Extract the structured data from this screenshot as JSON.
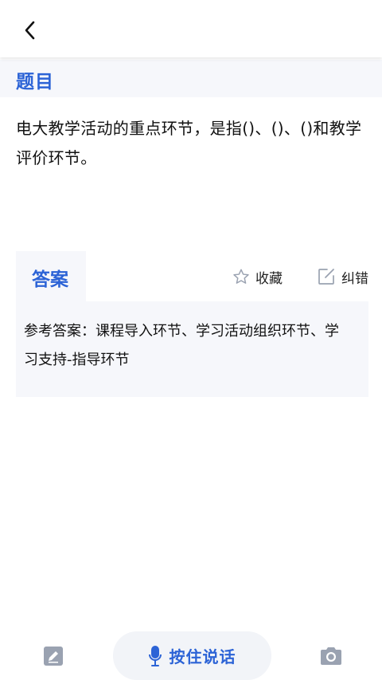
{
  "header": {
    "back_icon": "chevron-left-icon"
  },
  "question_section": {
    "title": "题目",
    "text": "电大教学活动的重点环节，是指()、()、()和教学评价环节。"
  },
  "answer_section": {
    "tab_label": "答案",
    "favorite_label": "收藏",
    "favorite_icon": "star-outline-icon",
    "correct_label": "纠错",
    "correct_icon": "edit-square-icon",
    "answer_text": "参考答案：课程导入环节、学习活动组织环节、学习支持-指导环节"
  },
  "bottom_bar": {
    "voice_label": "按住说话",
    "left_icon": "note-edit-icon",
    "mic_icon": "microphone-icon",
    "right_icon": "camera-icon"
  },
  "colors": {
    "accent": "#2c63d6",
    "panel_bg": "#f6f7fb",
    "icon_gray": "#9aa2b1"
  }
}
